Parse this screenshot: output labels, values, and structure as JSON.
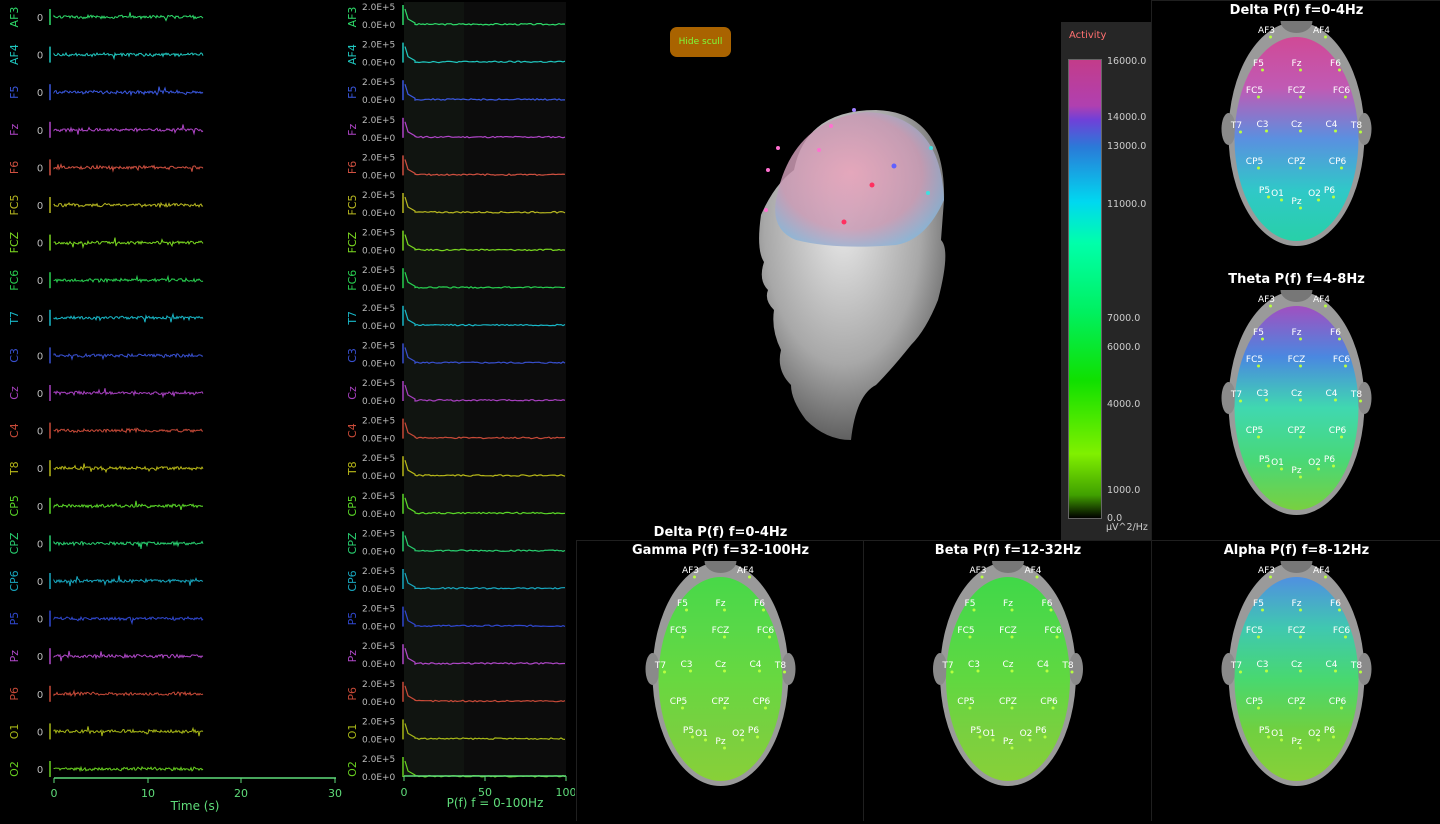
{
  "eeg": {
    "channels": [
      {
        "name": "AF3",
        "color": "#2edc6a"
      },
      {
        "name": "AF4",
        "color": "#20c8c0"
      },
      {
        "name": "F5",
        "color": "#3a58e0"
      },
      {
        "name": "Fz",
        "color": "#b045c8"
      },
      {
        "name": "F6",
        "color": "#d05040"
      },
      {
        "name": "FC5",
        "color": "#b8b820"
      },
      {
        "name": "FCZ",
        "color": "#7ad820"
      },
      {
        "name": "FC6",
        "color": "#28d050"
      },
      {
        "name": "T7",
        "color": "#18b8c8"
      },
      {
        "name": "C3",
        "color": "#3850d0"
      },
      {
        "name": "Cz",
        "color": "#a840c0"
      },
      {
        "name": "C4",
        "color": "#c84a38"
      },
      {
        "name": "T8",
        "color": "#b8b818"
      },
      {
        "name": "CP5",
        "color": "#5ad828"
      },
      {
        "name": "CPZ",
        "color": "#28d070"
      },
      {
        "name": "CP6",
        "color": "#18a8c0"
      },
      {
        "name": "P5",
        "color": "#3048d0"
      },
      {
        "name": "Pz",
        "color": "#b048c8"
      },
      {
        "name": "P6",
        "color": "#c84a38"
      },
      {
        "name": "O1",
        "color": "#a8b818"
      },
      {
        "name": "O2",
        "color": "#68d020"
      }
    ],
    "zero_label": "0",
    "x_ticks": [
      "0",
      "10",
      "20",
      "30"
    ],
    "x_label": "Time (s)"
  },
  "psd": {
    "y_top": "2.0E+5",
    "y_bottom": "0.0E+0",
    "x_ticks": [
      "0",
      "50",
      "100"
    ],
    "x_label": "P(f) f = 0-100Hz"
  },
  "center": {
    "hide_button": "Hide scull",
    "colorbar": {
      "title": "Activity",
      "labels": [
        "16000.0",
        "14000.0",
        "13000.0",
        "11000.0",
        "7000.0",
        "6000.0",
        "4000.0",
        "1000.0",
        "0.0"
      ],
      "unit": "µV^2/Hz"
    },
    "overlay_title": "Delta P(f) f=0-4Hz"
  },
  "maps": {
    "delta": {
      "title": "Delta P(f) f=0-4Hz",
      "colors": [
        "#d04a96",
        "#c05ab4",
        "#5a90e0",
        "#30c8c8",
        "#28d0a8"
      ]
    },
    "theta": {
      "title": "Theta P(f) f=4-8Hz",
      "colors": [
        "#a050c0",
        "#4a88e0",
        "#40d8b0",
        "#48d878",
        "#78d040"
      ]
    },
    "gamma": {
      "title": "Gamma P(f) f=32-100Hz",
      "colors": [
        "#48d848",
        "#58d848",
        "#68d840",
        "#78d040",
        "#88d038"
      ]
    },
    "beta": {
      "title": "Beta P(f) f=12-32Hz",
      "colors": [
        "#40d848",
        "#50d848",
        "#60d840",
        "#78d040",
        "#88d038"
      ]
    },
    "alpha": {
      "title": "Alpha P(f) f=8-12Hz",
      "colors": [
        "#5090e0",
        "#40c8b0",
        "#48d870",
        "#70d040",
        "#88d038"
      ]
    },
    "electrodes": [
      "AF3",
      "AF4",
      "F5",
      "Fz",
      "F6",
      "FC5",
      "FCZ",
      "FC6",
      "T7",
      "C3",
      "Cz",
      "C4",
      "T8",
      "CP5",
      "CPZ",
      "CP6",
      "P5",
      "O1",
      "Pz",
      "O2",
      "P6"
    ]
  }
}
